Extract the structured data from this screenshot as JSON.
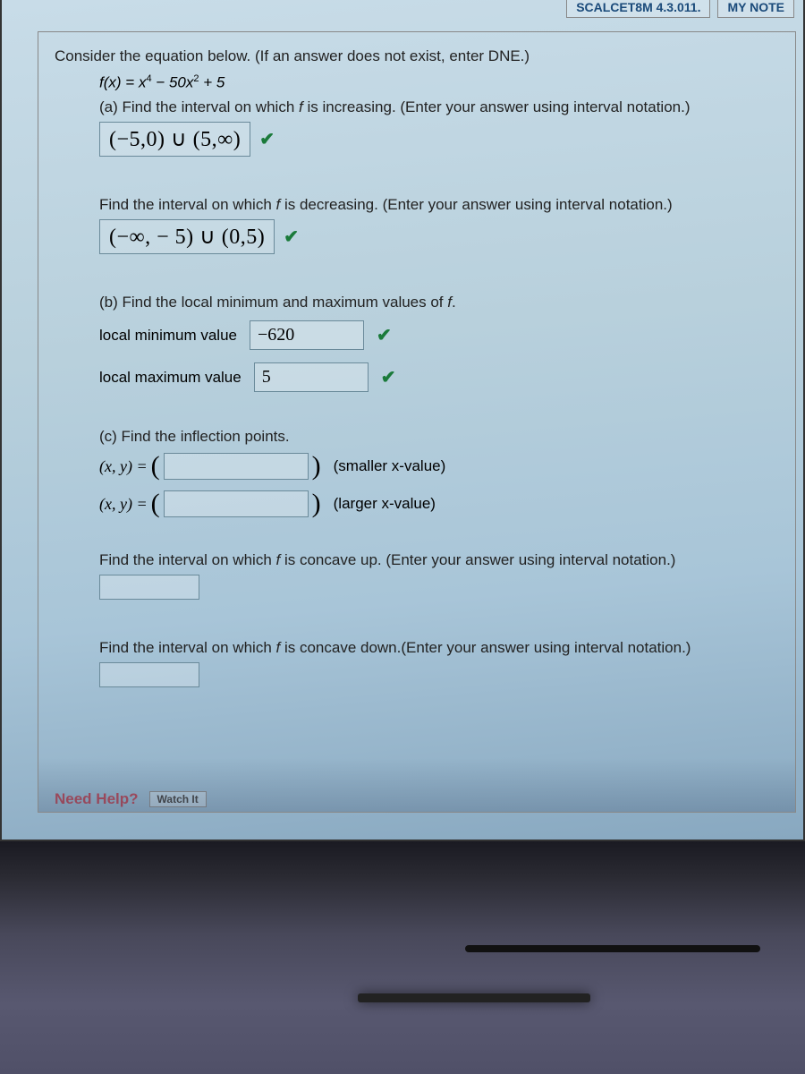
{
  "header": {
    "partial_label_1": "SCALCET8M 4.3.011.",
    "partial_label_2": "MY NOTE"
  },
  "question": {
    "intro": "Consider the equation below. (If an answer does not exist, enter DNE.)",
    "equation_text": "f(x) = x⁴ − 50x² + 5",
    "parts": {
      "a": {
        "increasing_prompt": "(a) Find the interval on which f is increasing. (Enter your answer using interval notation.)",
        "increasing_answer": "(−5,0) ∪ (5,∞)",
        "decreasing_prompt": "Find the interval on which f is decreasing. (Enter your answer using interval notation.)",
        "decreasing_answer": "(−∞, − 5) ∪ (0,5)"
      },
      "b": {
        "prompt": "(b) Find the local minimum and maximum values of f.",
        "min_label": "local minimum value",
        "min_value": "−620",
        "max_label": "local maximum value",
        "max_value": "5"
      },
      "c": {
        "prompt": "(c) Find the inflection points.",
        "xy_label": "(x, y) = ",
        "smaller_hint": "(smaller x-value)",
        "larger_hint": "(larger x-value)",
        "concave_up_prompt": "Find the interval on which f is concave up. (Enter your answer using interval notation.)",
        "concave_down_prompt": "Find the interval on which f is concave down.(Enter your answer using interval notation.)"
      }
    }
  },
  "footer": {
    "need_help": "Need Help?",
    "watch_it": "Watch It"
  },
  "status": {
    "correct_mark": "✔"
  }
}
